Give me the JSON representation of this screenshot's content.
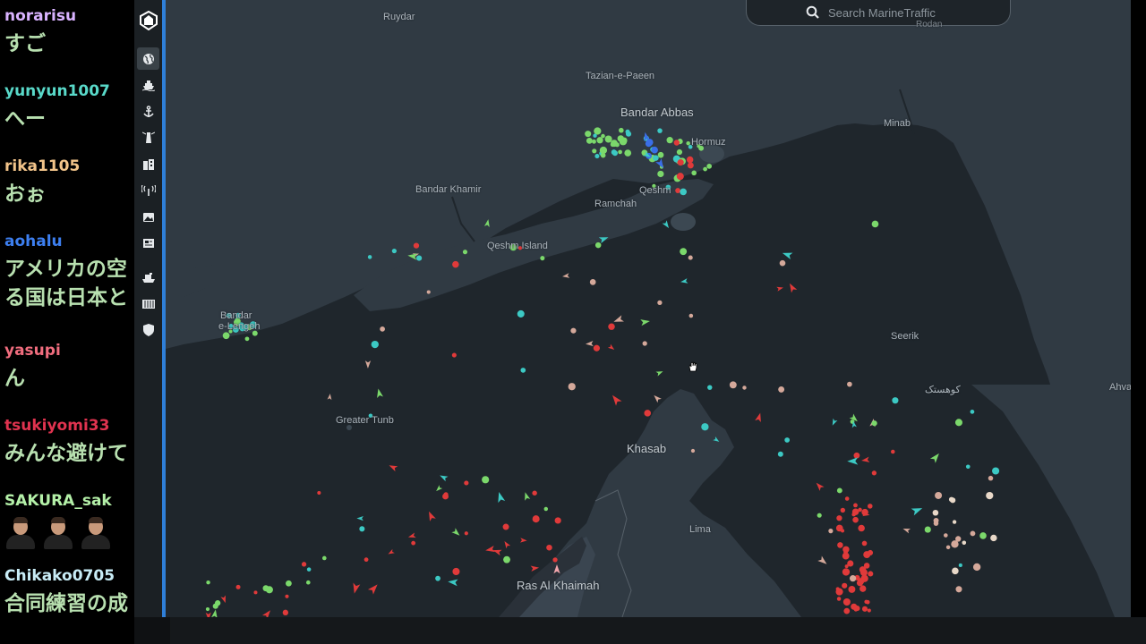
{
  "chat": [
    {
      "user": "norarisu",
      "color": "#d9b3ff",
      "text": "すご"
    },
    {
      "user": "yunyun1007",
      "color": "#59d9c9",
      "text": "へー"
    },
    {
      "user": "rika1105",
      "color": "#f2c48a",
      "text": "おぉ"
    },
    {
      "user": "aohalu",
      "color": "#3d7ff0",
      "text": "アメリカの空",
      "text2": "る国は日本と"
    },
    {
      "user": "yasupi",
      "color": "#f06d7e",
      "text": "ん"
    },
    {
      "user": "tsukiyomi33",
      "color": "#e0334f",
      "text": "みんな避けて"
    },
    {
      "user": "SAKURA_sak",
      "color": "#b4f0a8",
      "text": ""
    },
    {
      "user": "Chikako0705",
      "color": "#c8ecf6",
      "text": "合同練習の成"
    }
  ],
  "sidebar": {
    "icons": [
      "logo-icon",
      "globe-icon",
      "ship-icon",
      "anchor-icon",
      "lighthouse-icon",
      "building-icon",
      "antenna-icon",
      "photo-icon",
      "news-icon",
      "fleet-icon",
      "container-icon",
      "shield-icon"
    ]
  },
  "search": {
    "placeholder": "Search MarineTraffic",
    "top_label": "Rodan"
  },
  "places": [
    {
      "id": "ruydar",
      "text": "Ruydar"
    },
    {
      "id": "tazian",
      "text": "Tazian-e-Paeen"
    },
    {
      "id": "bandar-abbas",
      "text": "Bandar Abbas"
    },
    {
      "id": "hormuz",
      "text": "Hormuz"
    },
    {
      "id": "minab",
      "text": "Minab"
    },
    {
      "id": "bandar-khamir",
      "text": "Bandar Khamir"
    },
    {
      "id": "qeshm",
      "text": "Qeshm"
    },
    {
      "id": "ramchah",
      "text": "Ramchah"
    },
    {
      "id": "qeshm-island",
      "text": "Qeshm Island"
    },
    {
      "id": "bandar-e-lengeh-1",
      "text": "Bandar"
    },
    {
      "id": "bandar-e-lengeh-2",
      "text": "e-Lengeh"
    },
    {
      "id": "sirik",
      "text": "Seerik"
    },
    {
      "id": "kuhestak",
      "text": "کوهستک"
    },
    {
      "id": "ahva",
      "text": "Ahva"
    },
    {
      "id": "greater-tunb",
      "text": "Greater Tunb"
    },
    {
      "id": "khasab",
      "text": "Khasab"
    },
    {
      "id": "lima",
      "text": "Lima"
    },
    {
      "id": "ras-al-khaimah",
      "text": "Ras Al Khaimah"
    }
  ],
  "colors": {
    "sea": "#1f262c",
    "land": "#303a43",
    "tanker": "#e03a3a",
    "cargo": "#7bd86b",
    "passenger": "#3a6ee8",
    "tug": "#3cc9c4",
    "other": "#d4a89a"
  }
}
